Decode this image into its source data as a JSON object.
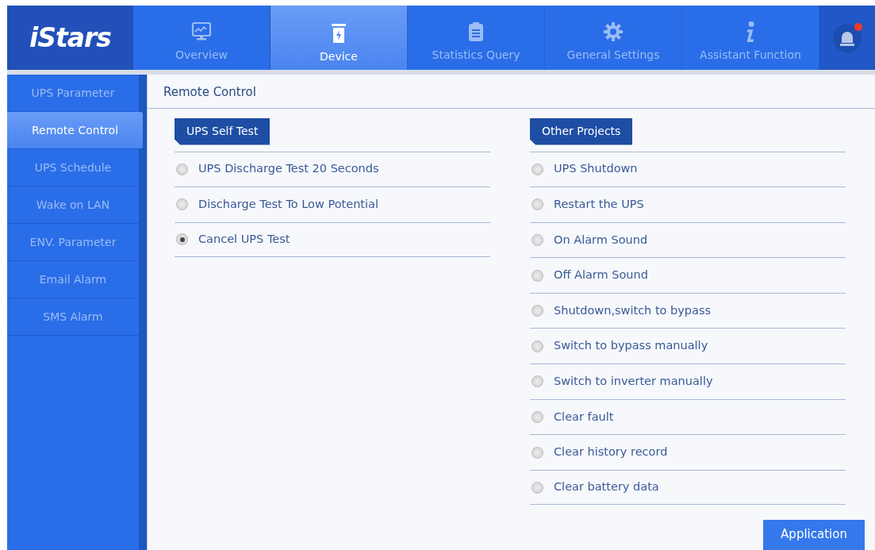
{
  "logo": "iStars",
  "tabs": [
    {
      "label": "Overview",
      "selected": false
    },
    {
      "label": "Device",
      "selected": true
    },
    {
      "label": "Statistics Query",
      "selected": false
    },
    {
      "label": "General Settings",
      "selected": false
    },
    {
      "label": "Assistant Function",
      "selected": false
    }
  ],
  "alarm": {
    "alert": true
  },
  "sidebar": {
    "items": [
      {
        "label": "UPS Parameter",
        "selected": false
      },
      {
        "label": "Remote Control",
        "selected": true
      },
      {
        "label": "UPS Schedule",
        "selected": false
      },
      {
        "label": "Wake on LAN",
        "selected": false
      },
      {
        "label": "ENV. Parameter",
        "selected": false
      },
      {
        "label": "Email Alarm",
        "selected": false
      },
      {
        "label": "SMS Alarm",
        "selected": false
      }
    ]
  },
  "panel": {
    "title": "Remote Control",
    "groups": [
      {
        "title": "UPS Self Test",
        "options": [
          {
            "label": "UPS Discharge Test 20 Seconds",
            "selected": false
          },
          {
            "label": "Discharge Test To Low Potential",
            "selected": false
          },
          {
            "label": "Cancel UPS Test",
            "selected": true
          }
        ]
      },
      {
        "title": "Other Projects",
        "options": [
          {
            "label": "UPS Shutdown",
            "selected": false
          },
          {
            "label": "Restart the UPS",
            "selected": false
          },
          {
            "label": "On Alarm Sound",
            "selected": false
          },
          {
            "label": "Off Alarm Sound",
            "selected": false
          },
          {
            "label": "Shutdown,switch to bypass",
            "selected": false
          },
          {
            "label": "Switch to bypass manually",
            "selected": false
          },
          {
            "label": "Switch to inverter manually",
            "selected": false
          },
          {
            "label": "Clear fault",
            "selected": false
          },
          {
            "label": "Clear history record",
            "selected": false
          },
          {
            "label": "Clear battery data",
            "selected": false
          }
        ]
      }
    ],
    "button": "Application"
  }
}
